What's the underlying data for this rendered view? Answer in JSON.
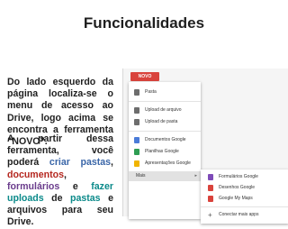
{
  "title": "Funcionalidades",
  "paragraph1": "Do lado esquerdo da página localiza-se o menu de acesso ao Drive, logo acima se encontra a ferramenta “NOVO”.",
  "paragraph2": {
    "intro": "A partir dessa ferramenta, você poderá",
    "link_criar_pastas": "criar pastas",
    "sep1": ",",
    "link_documentos": "documentos",
    "sep2": ",",
    "link_formularios": "formulários",
    "and": "e",
    "link_fazer_uploads": "fazer uploads",
    "de": "de",
    "link_pastas": "pastas",
    "outro": "e arquivos para seu Drive."
  },
  "drive_menu": {
    "novo_label": "NOVO",
    "items": [
      {
        "label": "Pasta",
        "icon": "folder-icon",
        "color": "#6d6d6d"
      },
      {
        "label": "Upload de arquivo",
        "icon": "file-upload-icon",
        "color": "#6d6d6d"
      },
      {
        "label": "Upload de pasta",
        "icon": "folder-upload-icon",
        "color": "#6d6d6d"
      },
      {
        "label": "Documentos Google",
        "icon": "docs-icon",
        "color": "#4a7bd8"
      },
      {
        "label": "Planilhas Google",
        "icon": "sheets-icon",
        "color": "#2e9d53"
      },
      {
        "label": "Apresentações Google",
        "icon": "slides-icon",
        "color": "#f0b400"
      },
      {
        "label": "Mais",
        "icon": "chevron-right-icon",
        "color": "#666666"
      }
    ]
  },
  "more_menu": {
    "items": [
      {
        "label": "Formulários Google",
        "icon": "forms-icon",
        "color": "#7e4bb8"
      },
      {
        "label": "Desenhos Google",
        "icon": "drawings-icon",
        "color": "#d9433c"
      },
      {
        "label": "Google My Maps",
        "icon": "maps-icon",
        "color": "#d9433c"
      },
      {
        "label": "Conectar mais apps",
        "icon": "plus-icon",
        "color": "#555555"
      }
    ]
  }
}
